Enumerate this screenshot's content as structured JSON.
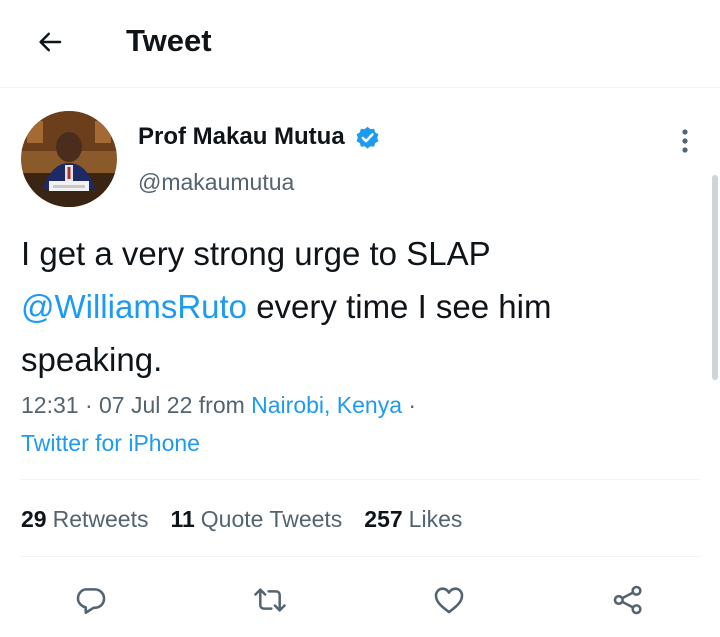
{
  "header": {
    "title": "Tweet",
    "back_icon": "arrow-left-icon"
  },
  "author": {
    "name": "Prof Makau Mutua",
    "handle": "@makaumutua",
    "verified": true,
    "verified_color": "#1d9bf0"
  },
  "tweet": {
    "text_before": "I get a very strong urge to SLAP ",
    "mention": "@WilliamsRuto",
    "text_after": " every time I see him speaking."
  },
  "meta": {
    "time": "12:31",
    "sep1": " · ",
    "date": "07 Jul 22",
    "from_label": " from ",
    "location": "Nairobi, Kenya",
    "sep2": " · ",
    "source": "Twitter for iPhone"
  },
  "stats": {
    "retweets_count": "29",
    "retweets_label": "Retweets",
    "quotes_count": "11",
    "quotes_label": "Quote Tweets",
    "likes_count": "257",
    "likes_label": "Likes"
  },
  "actions": [
    "reply-icon",
    "retweet-icon",
    "like-icon",
    "share-icon"
  ],
  "colors": {
    "accent": "#1d9bf0",
    "text": "#0f1419",
    "secondary": "#536471",
    "divider": "#eff3f4"
  }
}
